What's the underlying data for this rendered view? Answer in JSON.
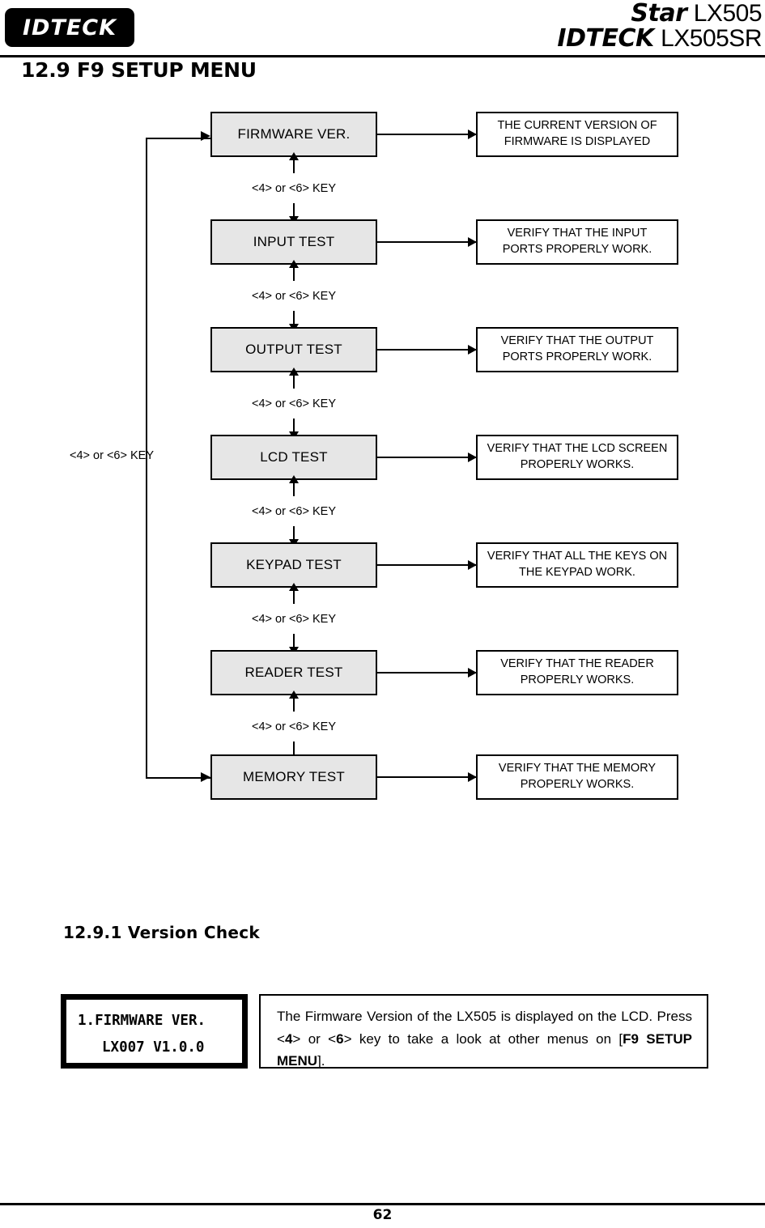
{
  "header": {
    "logo_text": "IDTECK",
    "brand_line_1_accent": "Star",
    "brand_line_1_model": "LX505",
    "brand_line_2_accent": "IDTECK",
    "brand_line_2_model": "LX505SR"
  },
  "section": {
    "title": "12.9 F9 SETUP MENU",
    "subsection_title": "12.9.1 Version Check"
  },
  "flowchart": {
    "key_label": "<4> or <6> KEY",
    "loop_label": "<4> or <6> KEY",
    "steps": [
      {
        "menu": "FIRMWARE VER.",
        "desc_line_1": "THE CURRENT VERSION OF",
        "desc_line_2": "FIRMWARE IS DISPLAYED"
      },
      {
        "menu": "INPUT TEST",
        "desc_line_1": "VERIFY THAT THE INPUT",
        "desc_line_2": "PORTS PROPERLY WORK."
      },
      {
        "menu": "OUTPUT TEST",
        "desc_line_1": "VERIFY THAT THE OUTPUT",
        "desc_line_2": "PORTS PROPERLY WORK."
      },
      {
        "menu": "LCD TEST",
        "desc_line_1": "VERIFY THAT THE LCD SCREEN",
        "desc_line_2": "PROPERLY WORKS."
      },
      {
        "menu": "KEYPAD TEST",
        "desc_line_1": "VERIFY THAT ALL THE KEYS ON",
        "desc_line_2": "THE KEYPAD WORK."
      },
      {
        "menu": "READER TEST",
        "desc_line_1": "VERIFY THAT THE READER",
        "desc_line_2": "PROPERLY WORKS."
      },
      {
        "menu": "MEMORY TEST",
        "desc_line_1": "VERIFY THAT THE MEMORY",
        "desc_line_2": "PROPERLY WORKS."
      }
    ]
  },
  "lcd": {
    "line_1": "1.FIRMWARE VER.",
    "line_2": "LX007 V1.0.0"
  },
  "explanation": {
    "part_1": "The Firmware Version of the LX505 is displayed on the LCD. Press <",
    "key_4": "4",
    "part_2": "> or <",
    "key_6": "6",
    "part_3": "> key to take a look at other menus on [",
    "menu_ref": "F9 SETUP MENU",
    "part_4": "]."
  },
  "footer": {
    "page_number": "62"
  }
}
